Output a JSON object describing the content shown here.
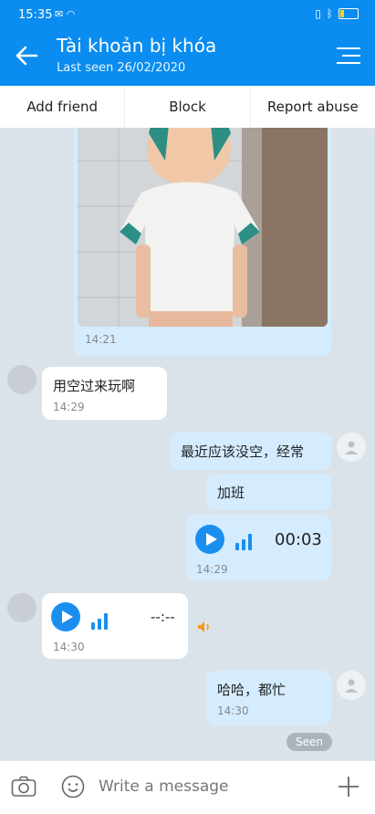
{
  "status_bar": {
    "time": "15:35"
  },
  "header": {
    "title": "Tài khoản bị khóa",
    "subtitle": "Last seen 26/02/2020"
  },
  "actions": {
    "add_friend": "Add friend",
    "block": "Block",
    "report": "Report abuse"
  },
  "messages": {
    "photo_time": "14:21",
    "m1": {
      "text": "用空过来玩啊",
      "time": "14:29"
    },
    "m2a": {
      "text": "最近应该没空，经常"
    },
    "m2b": {
      "text": "加班"
    },
    "voice1": {
      "duration": "00:03",
      "time": "14:29"
    },
    "voice2": {
      "duration": "--:--",
      "time": "14:30"
    },
    "m3": {
      "text": "哈哈，都忙",
      "time": "14:30"
    },
    "seen": "Seen"
  },
  "input": {
    "placeholder": "Write a message"
  }
}
